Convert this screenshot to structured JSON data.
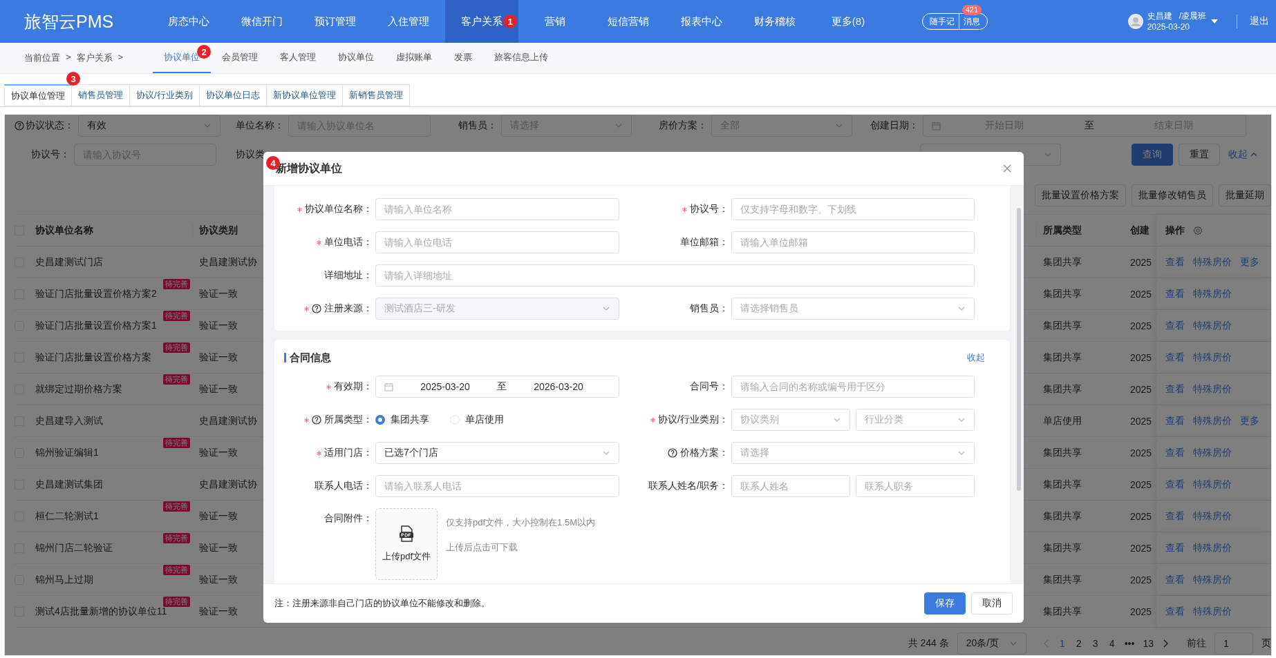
{
  "app": {
    "logo": "旅智云PMS"
  },
  "nav": {
    "items": [
      {
        "label": "房态中心",
        "selected": false
      },
      {
        "label": "微信开门",
        "selected": false
      },
      {
        "label": "预订管理",
        "selected": false
      },
      {
        "label": "入住管理",
        "selected": false
      },
      {
        "label": "客户关系",
        "selected": true,
        "marker": "1"
      },
      {
        "label": "营销",
        "selected": false
      },
      {
        "label": "短信营销",
        "selected": false
      },
      {
        "label": "报表中心",
        "selected": false
      },
      {
        "label": "财务稽核",
        "selected": false
      },
      {
        "label": "更多(8)",
        "selected": false
      }
    ],
    "notes_button": "随手记",
    "messages_button": "消息",
    "messages_badge": "421",
    "user": {
      "name": "史昌建",
      "shift": "/凌晨班",
      "date": "2025-03-20"
    },
    "logout": "退出"
  },
  "breadcrumb": [
    "当前位置",
    ">",
    "客户关系",
    ">"
  ],
  "subnav": [
    {
      "label": "协议单位",
      "selected": true,
      "marker": "2"
    },
    {
      "label": "会员管理",
      "selected": false
    },
    {
      "label": "客人管理",
      "selected": false
    },
    {
      "label": "协议单位",
      "selected": false
    },
    {
      "label": "虚拟账单",
      "selected": false
    },
    {
      "label": "发票",
      "selected": false
    },
    {
      "label": "旅客信息上传",
      "selected": false
    }
  ],
  "tabs": [
    {
      "label": "协议单位管理",
      "selected": true,
      "marker": "3"
    },
    {
      "label": "销售员管理",
      "selected": false
    },
    {
      "label": "协议/行业类别",
      "selected": false
    },
    {
      "label": "协议单位日志",
      "selected": false
    },
    {
      "label": "新协议单位管理",
      "selected": false
    },
    {
      "label": "新销售员管理",
      "selected": false
    }
  ],
  "filters": {
    "rows": [
      [
        {
          "label": "协议状态：",
          "help": true,
          "kind": "select",
          "value": "有效"
        },
        {
          "label": "单位名称：",
          "kind": "input",
          "placeholder": "请输入协议单位名"
        },
        {
          "label": "销售员：",
          "kind": "select",
          "placeholder": "请选择"
        },
        {
          "label": "房价方案：",
          "kind": "select",
          "placeholder": "全部"
        },
        {
          "label": "创建日期：",
          "kind": "daterange",
          "start_placeholder": "开始日期",
          "separator": "至",
          "end_placeholder": "结束日期"
        }
      ],
      [
        {
          "label": "协议号：",
          "kind": "input",
          "placeholder": "请输入协议号"
        },
        {
          "label": "协议类",
          "kind": "none"
        },
        {
          "kind": "none"
        },
        {
          "kind": "none"
        },
        {
          "kind": "select"
        }
      ]
    ],
    "buttons": [
      {
        "label": "查询",
        "kind": "primary"
      },
      {
        "label": "重置",
        "kind": "default"
      },
      {
        "label": "收起",
        "kind": "link"
      }
    ],
    "batch_buttons": [
      "批量设置价格方案",
      "批量修改销售员",
      "批量延期"
    ]
  },
  "table": {
    "header_checked": false,
    "columns": {
      "name": "协议单位名称",
      "category": "协议类别",
      "type": "所属类型",
      "created": "创建",
      "actions": "操作"
    },
    "rows": [
      {
        "checked": false,
        "name": "史昌建测试门店",
        "category": "史昌建测试协",
        "type": "集团共享",
        "created": "2025",
        "actions": [
          "查看",
          "特殊房价",
          "更多"
        ]
      },
      {
        "checked": false,
        "name": "验证门店批量设置价格方案2",
        "tag": "待完善",
        "category": "验证一致",
        "type": "集团共享",
        "created": "2025",
        "actions": [
          "查看",
          "特殊房价"
        ]
      },
      {
        "checked": false,
        "name": "验证门店批量设置价格方案1",
        "tag": "待完善",
        "category": "验证一致",
        "type": "集团共享",
        "created": "2025",
        "actions": [
          "查看",
          "特殊房价"
        ]
      },
      {
        "checked": false,
        "name": "验证门店批量设置价格方案",
        "tag": "待完善",
        "category": "验证一致",
        "type": "集团共享",
        "created": "2025",
        "actions": [
          "查看",
          "特殊房价"
        ]
      },
      {
        "checked": false,
        "name": "就绑定过期价格方案",
        "tag": "待完善",
        "category": "验证一致",
        "type": "集团共享",
        "created": "2025",
        "actions": [
          "查看",
          "特殊房价"
        ]
      },
      {
        "checked": false,
        "name": "史昌建导入测试",
        "category": "史昌建测试协",
        "type": "单店使用",
        "created": "2025",
        "actions": [
          "查看",
          "特殊房价",
          "更多"
        ]
      },
      {
        "checked": false,
        "name": "锦州验证编辑1",
        "tag": "待完善",
        "category": "验证一致",
        "type": "集团共享",
        "created": "2025",
        "actions": [
          "查看",
          "特殊房价"
        ]
      },
      {
        "checked": false,
        "name": "史昌建测试集团",
        "category": "史昌建测试协",
        "type": "集团共享",
        "created": "2025",
        "actions": [
          "查看",
          "特殊房价"
        ]
      },
      {
        "checked": false,
        "name": "桓仁二轮测试1",
        "tag": "待完善",
        "category": "验证一致",
        "type": "集团共享",
        "created": "2025",
        "actions": [
          "查看",
          "特殊房价"
        ]
      },
      {
        "checked": false,
        "name": "锦州门店二轮验证",
        "tag": "待完善",
        "category": "验证一致",
        "type": "集团共享",
        "created": "2025",
        "actions": [
          "查看",
          "特殊房价"
        ]
      },
      {
        "checked": false,
        "name": "锦州马上过期",
        "tag": "待完善",
        "category": "验证一致",
        "type": "集团共享",
        "created": "2025",
        "actions": [
          "查看",
          "特殊房价"
        ]
      },
      {
        "checked": false,
        "name": "测试4店批量新增的协议单位11",
        "tag": "待完善",
        "category": "验证一致",
        "type": "集团共享",
        "created": "2025",
        "actions": [
          "查看",
          "特殊房价"
        ]
      }
    ]
  },
  "pagination": {
    "total": "共 244 条",
    "page_size": "20条/页",
    "pages": [
      {
        "kind": "page",
        "label": "1",
        "selected": true
      },
      {
        "kind": "page",
        "label": "2",
        "selected": false
      },
      {
        "kind": "page",
        "label": "3",
        "selected": false
      },
      {
        "kind": "page",
        "label": "4",
        "selected": false
      },
      {
        "kind": "ellipsis",
        "label": "•••"
      },
      {
        "kind": "page",
        "label": "13",
        "selected": false
      }
    ],
    "prev_disabled": true,
    "goto_label": "前往",
    "goto_value": "1",
    "goto_suffix": "页"
  },
  "modal": {
    "title": "新增协议单位",
    "marker": "4",
    "sections": [
      {
        "rows": [
          [
            {
              "label": "协议单位名称：",
              "required": true,
              "control": {
                "kind": "input",
                "placeholder": "请输入单位名称"
              }
            },
            {
              "label": "协议号：",
              "required": true,
              "control": {
                "kind": "input",
                "placeholder": "仅支持字母和数字、下划线"
              }
            }
          ],
          [
            {
              "label": "单位电话：",
              "required": true,
              "control": {
                "kind": "input",
                "placeholder": "请输入单位电话"
              }
            },
            {
              "label": "单位邮箱：",
              "control": {
                "kind": "input",
                "placeholder": "请输入单位邮箱"
              }
            }
          ],
          [
            {
              "label": "详细地址：",
              "control": {
                "kind": "input",
                "placeholder": "请输入详细地址"
              }
            }
          ],
          [
            {
              "label": "注册来源：",
              "required": true,
              "help": true,
              "control": {
                "kind": "select",
                "value": "测试酒店三-研发",
                "disabled": true
              }
            },
            {
              "label": "销售员：",
              "control": {
                "kind": "select",
                "placeholder": "请选择销售员"
              }
            }
          ]
        ]
      },
      {
        "title": "合同信息",
        "link": "收起",
        "rows": [
          [
            {
              "label": "有效期：",
              "required": true,
              "control": {
                "kind": "daterange",
                "start": "2025-03-20",
                "separator": "至",
                "end": "2026-03-20"
              }
            },
            {
              "label": "合同号：",
              "control": {
                "kind": "input",
                "placeholder": "请输入合同的名称或编号用于区分"
              }
            }
          ],
          [
            {
              "label": "所属类型：",
              "required": true,
              "help": true,
              "control": {
                "kind": "radio",
                "options": [
                  {
                    "label": "集团共享",
                    "selected": true
                  },
                  {
                    "label": "单店使用",
                    "selected": false
                  }
                ]
              }
            },
            {
              "label": "协议/行业类别：",
              "required": true,
              "control": {
                "kind": "pair",
                "items": [
                  {
                    "kind": "select",
                    "placeholder": "协议类别"
                  },
                  {
                    "kind": "select",
                    "placeholder": "行业分类"
                  }
                ]
              }
            }
          ],
          [
            {
              "label": "适用门店：",
              "required": true,
              "control": {
                "kind": "select",
                "value": "已选7个门店"
              }
            },
            {
              "label": "价格方案：",
              "help": true,
              "control": {
                "kind": "select",
                "placeholder": "请选择"
              }
            }
          ],
          [
            {
              "label": "联系人电话：",
              "control": {
                "kind": "input",
                "placeholder": "请输入联系人电话"
              }
            },
            {
              "label": "联系人姓名/职务：",
              "control": {
                "kind": "pair",
                "items": [
                  {
                    "kind": "input",
                    "placeholder": "联系人姓名"
                  },
                  {
                    "kind": "input",
                    "placeholder": "联系人职务"
                  }
                ]
              }
            }
          ],
          [
            {
              "label": "合同附件：",
              "control": {
                "kind": "upload",
                "button": "上传pdf文件",
                "hints": [
                  "仅支持pdf文件，大小控制在1.5M以内",
                  "上传后点击可下载"
                ]
              }
            }
          ]
        ]
      }
    ],
    "note": "注：注册来源非自己门店的协议单位不能修改和删除。",
    "buttons": [
      {
        "label": "保存",
        "kind": "primary"
      },
      {
        "label": "取消",
        "kind": "default"
      }
    ]
  }
}
